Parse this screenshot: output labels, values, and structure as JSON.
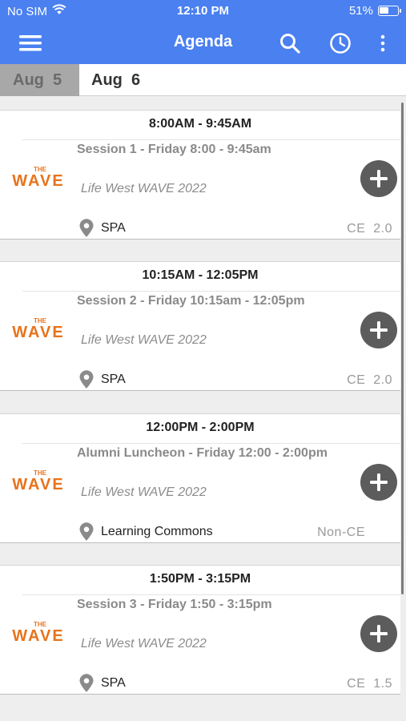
{
  "status_bar": {
    "carrier": "No SIM",
    "time": "12:10 PM",
    "battery": "51%",
    "battery_level": 0.51
  },
  "nav": {
    "title": "Agenda",
    "menu_icon": "hamburger-menu-icon",
    "search_icon": "search-icon",
    "clock_icon": "clock-icon",
    "more_icon": "more-vertical-icon"
  },
  "tabs": [
    {
      "label": "Aug  5",
      "selected": true
    },
    {
      "label": "Aug  6",
      "selected": false
    }
  ],
  "logo": {
    "small": "THE",
    "main": "WAVE",
    "color": "#e8731c"
  },
  "sessions": [
    {
      "time": "8:00AM - 9:45AM",
      "title": "Session 1 - Friday 8:00 - 9:45am",
      "event": "Life West WAVE 2022",
      "location": "SPA",
      "ce": "CE  2.0"
    },
    {
      "time": "10:15AM - 12:05PM",
      "title": "Session 2 - Friday 10:15am - 12:05pm",
      "event": "Life West WAVE 2022",
      "location": "SPA",
      "ce": "CE  2.0"
    },
    {
      "time": "12:00PM - 2:00PM",
      "title": "Alumni Luncheon - Friday 12:00 - 2:00pm",
      "event": "Life West WAVE 2022",
      "location": "Learning Commons",
      "ce": "Non-CE"
    },
    {
      "time": "1:50PM - 3:15PM",
      "title": "Session 3 - Friday 1:50 - 3:15pm",
      "event": "Life West WAVE 2022",
      "location": "SPA",
      "ce": "CE  1.5"
    }
  ],
  "colors": {
    "nav_bar": "#4a80f0",
    "add_button": "#5c5c5c",
    "location_pin": "#8a8a8a"
  }
}
